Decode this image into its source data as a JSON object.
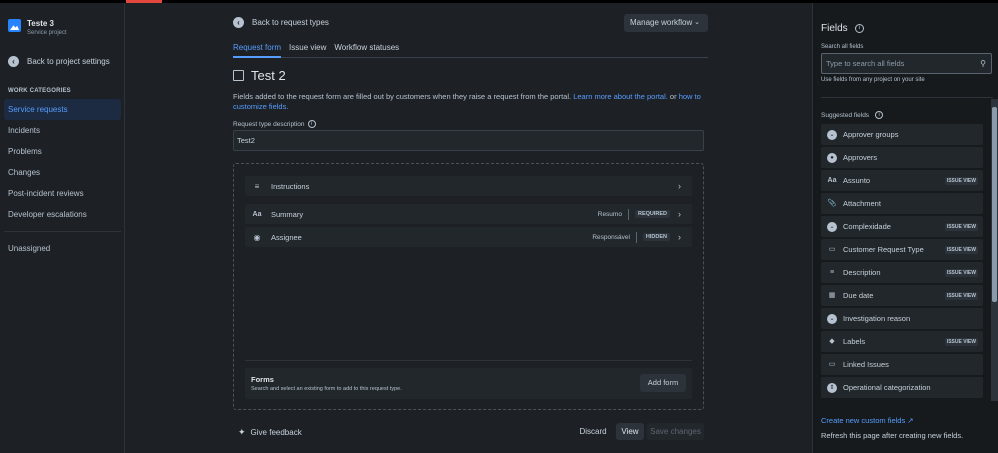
{
  "sidebar": {
    "project_name": "Teste 3",
    "project_type": "Service project",
    "back_label": "Back to project settings",
    "section_label": "WORK CATEGORIES",
    "items": [
      {
        "label": "Service requests"
      },
      {
        "label": "Incidents"
      },
      {
        "label": "Problems"
      },
      {
        "label": "Changes"
      },
      {
        "label": "Post-incident reviews"
      },
      {
        "label": "Developer escalations"
      }
    ],
    "unassigned_label": "Unassigned"
  },
  "header": {
    "back_label": "Back to request types",
    "manage_label": "Manage workflow"
  },
  "tabs": [
    {
      "label": "Request form"
    },
    {
      "label": "Issue view"
    },
    {
      "label": "Workflow statuses"
    }
  ],
  "request": {
    "title": "Test 2",
    "desc_text": "Fields added to the request form are filled out by customers when they raise a request from the portal. ",
    "desc_link1": "Learn more about the portal.",
    "desc_or": " or ",
    "desc_link2": "how to customize fields.",
    "rtd_label": "Request type description",
    "rtd_value": "Test2"
  },
  "form_fields": [
    {
      "name": "Instructions",
      "value": "",
      "badge": ""
    },
    {
      "name": "Summary",
      "value": "Resumo",
      "badge": "REQUIRED"
    },
    {
      "name": "Assignee",
      "value": "Responsável",
      "badge": "HIDDEN"
    }
  ],
  "forms": {
    "title": "Forms",
    "subtitle": "Search and select an existing form to add to this request type.",
    "add_label": "Add form"
  },
  "footer": {
    "feedback": "Give feedback",
    "discard": "Discard",
    "view": "View",
    "save": "Save changes"
  },
  "panel": {
    "title": "Fields",
    "search_label": "Search all fields",
    "search_placeholder": "Type to search all fields",
    "search_help": "Use fields from any project on your site",
    "suggested_label": "Suggested fields",
    "items": [
      {
        "name": "Approver groups",
        "badge": ""
      },
      {
        "name": "Approvers",
        "badge": ""
      },
      {
        "name": "Assunto",
        "badge": "ISSUE VIEW"
      },
      {
        "name": "Attachment",
        "badge": ""
      },
      {
        "name": "Complexidade",
        "badge": "ISSUE VIEW"
      },
      {
        "name": "Customer Request Type",
        "badge": "ISSUE VIEW"
      },
      {
        "name": "Description",
        "badge": "ISSUE VIEW"
      },
      {
        "name": "Due date",
        "badge": "ISSUE VIEW"
      },
      {
        "name": "Investigation reason",
        "badge": ""
      },
      {
        "name": "Labels",
        "badge": "ISSUE VIEW"
      },
      {
        "name": "Linked Issues",
        "badge": ""
      },
      {
        "name": "Operational categorization",
        "badge": ""
      }
    ],
    "create_link": "Create new custom fields",
    "refresh_text": "Refresh this page after creating new fields."
  }
}
